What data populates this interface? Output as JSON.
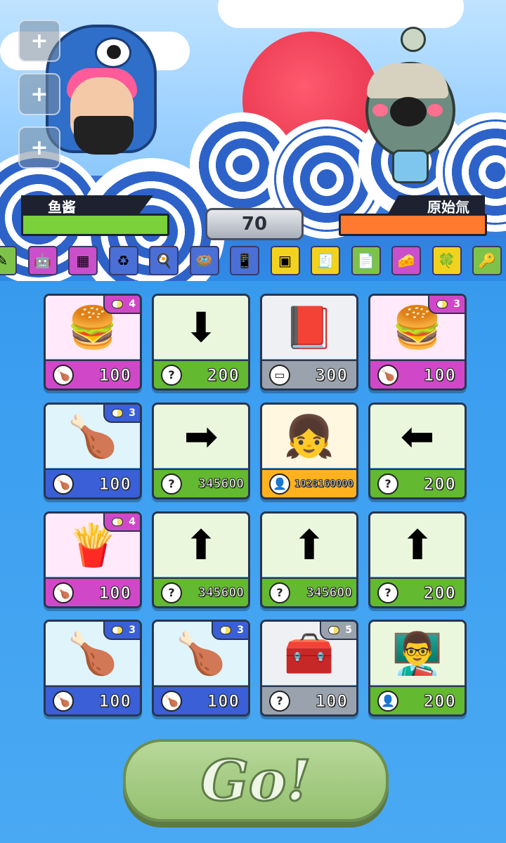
{
  "colors": {
    "pink_top": "#ffe9fb",
    "pink_bot": "#d048c8",
    "green_top": "#eaf7dd",
    "green_bot": "#63b92f",
    "gray_top": "#eef0f3",
    "gray_bot": "#9aa3ad",
    "blue_top": "#dff4fb",
    "blue_bot": "#3a5fd6",
    "yellow_top": "#fff7df",
    "yellow_bot": "#ffb21e",
    "player_hp": "#7ad13a",
    "enemy_hp": "#ff7a2e"
  },
  "player": {
    "name": "鱼酱"
  },
  "enemy": {
    "name": "原始氚"
  },
  "turn_counter": "70",
  "side_buttons": [
    "+",
    "+",
    "+"
  ],
  "inventory": [
    {
      "icon": "✎",
      "bg": "#7fc24a"
    },
    {
      "icon": "🤖",
      "bg": "#c94fcb"
    },
    {
      "icon": "▦",
      "bg": "#c94fcb"
    },
    {
      "icon": "♻",
      "bg": "#4a6fd6"
    },
    {
      "icon": "🍳",
      "bg": "#4a6fd6"
    },
    {
      "icon": "🪺",
      "bg": "#4a6fd6"
    },
    {
      "icon": "📱",
      "bg": "#4a6fd6"
    },
    {
      "icon": "▣",
      "bg": "#f2d21e"
    },
    {
      "icon": "🧾",
      "bg": "#f2d21e"
    },
    {
      "icon": "📄",
      "bg": "#7fc24a"
    },
    {
      "icon": "🧀",
      "bg": "#c94fcb"
    },
    {
      "icon": "🍀",
      "bg": "#f2d21e"
    },
    {
      "icon": "🔑",
      "bg": "#7fc24a"
    }
  ],
  "cards": [
    {
      "icon": "🍔",
      "theme": "pink",
      "cost_icon": "🍗",
      "cost": "100",
      "badge": "4",
      "badge_color": "pink"
    },
    {
      "icon": "⬇",
      "theme": "green",
      "cost_icon": "?",
      "cost": "200",
      "badge": ""
    },
    {
      "icon": "📕",
      "theme": "gray",
      "cost_icon": "▭",
      "cost": "300",
      "badge": ""
    },
    {
      "icon": "🍔",
      "theme": "pink",
      "cost_icon": "🍗",
      "cost": "100",
      "badge": "3",
      "badge_color": "pink"
    },
    {
      "icon": "🍗",
      "theme": "blue",
      "cost_icon": "🍗",
      "cost": "100",
      "badge": "3",
      "badge_color": "blue"
    },
    {
      "icon": "➡",
      "theme": "green",
      "cost_icon": "?",
      "cost": "345600",
      "badge": ""
    },
    {
      "icon": "👧",
      "theme": "yellow",
      "cost_icon": "👤",
      "cost": "1028160000",
      "badge": ""
    },
    {
      "icon": "⬅",
      "theme": "green",
      "cost_icon": "?",
      "cost": "200",
      "badge": ""
    },
    {
      "icon": "🍟",
      "theme": "pink",
      "cost_icon": "🍗",
      "cost": "100",
      "badge": "4",
      "badge_color": "pink"
    },
    {
      "icon": "⬆",
      "theme": "green",
      "cost_icon": "?",
      "cost": "345600",
      "badge": ""
    },
    {
      "icon": "⬆",
      "theme": "green",
      "cost_icon": "?",
      "cost": "345600",
      "badge": ""
    },
    {
      "icon": "⬆",
      "theme": "green",
      "cost_icon": "?",
      "cost": "200",
      "badge": ""
    },
    {
      "icon": "🍗",
      "theme": "blue",
      "cost_icon": "🍗",
      "cost": "100",
      "badge": "3",
      "badge_color": "blue"
    },
    {
      "icon": "🍗",
      "theme": "blue",
      "cost_icon": "🍗",
      "cost": "100",
      "badge": "3",
      "badge_color": "blue"
    },
    {
      "icon": "🧰",
      "theme": "gray",
      "cost_icon": "?",
      "cost": "100",
      "badge": "5",
      "badge_color": "gray"
    },
    {
      "icon": "👨‍🏫",
      "theme": "green",
      "cost_icon": "👤",
      "cost": "200",
      "badge": ""
    }
  ],
  "go_button": {
    "label": "Go!"
  }
}
